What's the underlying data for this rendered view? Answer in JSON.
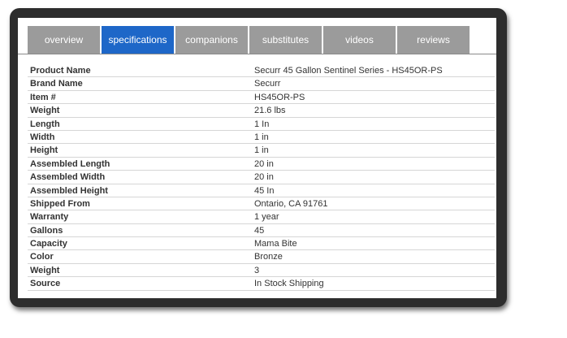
{
  "tabs": [
    {
      "label": "overview",
      "active": false
    },
    {
      "label": "specifications",
      "active": true
    },
    {
      "label": "companions",
      "active": false
    },
    {
      "label": "substitutes",
      "active": false
    },
    {
      "label": "videos",
      "active": false
    },
    {
      "label": "reviews",
      "active": false
    }
  ],
  "colors": {
    "active_tab": "#1e67c8",
    "inactive_tab": "#9b9b9b",
    "frame": "#2d2d2d"
  },
  "specs": [
    {
      "key": "Product Name",
      "value": "Securr 45 Gallon Sentinel Series - HS45OR-PS"
    },
    {
      "key": "Brand Name",
      "value": "Securr"
    },
    {
      "key": "Item #",
      "value": "HS45OR-PS"
    },
    {
      "key": "Weight",
      "value": "21.6 lbs"
    },
    {
      "key": "Length",
      "value": "1 In"
    },
    {
      "key": "Width",
      "value": "1 in"
    },
    {
      "key": "Height",
      "value": "1 in"
    },
    {
      "key": "Assembled Length",
      "value": "20 in"
    },
    {
      "key": "Assembled Width",
      "value": "20 in"
    },
    {
      "key": "Assembled Height",
      "value": "45 In"
    },
    {
      "key": "Shipped From",
      "value": "Ontario, CA 91761"
    },
    {
      "key": "Warranty",
      "value": "1 year"
    },
    {
      "key": "Gallons",
      "value": "45"
    },
    {
      "key": "Capacity",
      "value": "Mama Bite"
    },
    {
      "key": "Color",
      "value": "Bronze"
    },
    {
      "key": "Weight",
      "value": "3"
    },
    {
      "key": "Source",
      "value": "In Stock Shipping"
    }
  ]
}
